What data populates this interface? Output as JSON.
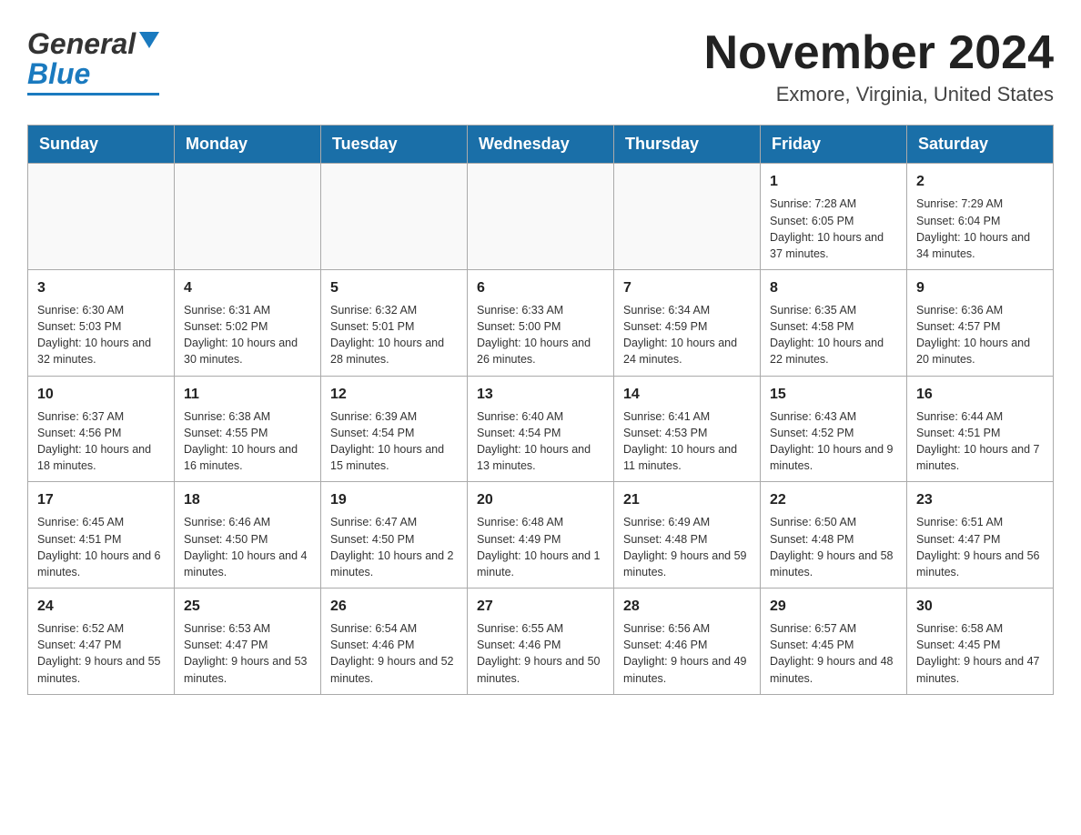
{
  "header": {
    "logo_general": "General",
    "logo_blue": "Blue",
    "title": "November 2024",
    "subtitle": "Exmore, Virginia, United States"
  },
  "calendar": {
    "days_of_week": [
      "Sunday",
      "Monday",
      "Tuesday",
      "Wednesday",
      "Thursday",
      "Friday",
      "Saturday"
    ],
    "weeks": [
      [
        {
          "day": "",
          "info": ""
        },
        {
          "day": "",
          "info": ""
        },
        {
          "day": "",
          "info": ""
        },
        {
          "day": "",
          "info": ""
        },
        {
          "day": "",
          "info": ""
        },
        {
          "day": "1",
          "info": "Sunrise: 7:28 AM\nSunset: 6:05 PM\nDaylight: 10 hours and 37 minutes."
        },
        {
          "day": "2",
          "info": "Sunrise: 7:29 AM\nSunset: 6:04 PM\nDaylight: 10 hours and 34 minutes."
        }
      ],
      [
        {
          "day": "3",
          "info": "Sunrise: 6:30 AM\nSunset: 5:03 PM\nDaylight: 10 hours and 32 minutes."
        },
        {
          "day": "4",
          "info": "Sunrise: 6:31 AM\nSunset: 5:02 PM\nDaylight: 10 hours and 30 minutes."
        },
        {
          "day": "5",
          "info": "Sunrise: 6:32 AM\nSunset: 5:01 PM\nDaylight: 10 hours and 28 minutes."
        },
        {
          "day": "6",
          "info": "Sunrise: 6:33 AM\nSunset: 5:00 PM\nDaylight: 10 hours and 26 minutes."
        },
        {
          "day": "7",
          "info": "Sunrise: 6:34 AM\nSunset: 4:59 PM\nDaylight: 10 hours and 24 minutes."
        },
        {
          "day": "8",
          "info": "Sunrise: 6:35 AM\nSunset: 4:58 PM\nDaylight: 10 hours and 22 minutes."
        },
        {
          "day": "9",
          "info": "Sunrise: 6:36 AM\nSunset: 4:57 PM\nDaylight: 10 hours and 20 minutes."
        }
      ],
      [
        {
          "day": "10",
          "info": "Sunrise: 6:37 AM\nSunset: 4:56 PM\nDaylight: 10 hours and 18 minutes."
        },
        {
          "day": "11",
          "info": "Sunrise: 6:38 AM\nSunset: 4:55 PM\nDaylight: 10 hours and 16 minutes."
        },
        {
          "day": "12",
          "info": "Sunrise: 6:39 AM\nSunset: 4:54 PM\nDaylight: 10 hours and 15 minutes."
        },
        {
          "day": "13",
          "info": "Sunrise: 6:40 AM\nSunset: 4:54 PM\nDaylight: 10 hours and 13 minutes."
        },
        {
          "day": "14",
          "info": "Sunrise: 6:41 AM\nSunset: 4:53 PM\nDaylight: 10 hours and 11 minutes."
        },
        {
          "day": "15",
          "info": "Sunrise: 6:43 AM\nSunset: 4:52 PM\nDaylight: 10 hours and 9 minutes."
        },
        {
          "day": "16",
          "info": "Sunrise: 6:44 AM\nSunset: 4:51 PM\nDaylight: 10 hours and 7 minutes."
        }
      ],
      [
        {
          "day": "17",
          "info": "Sunrise: 6:45 AM\nSunset: 4:51 PM\nDaylight: 10 hours and 6 minutes."
        },
        {
          "day": "18",
          "info": "Sunrise: 6:46 AM\nSunset: 4:50 PM\nDaylight: 10 hours and 4 minutes."
        },
        {
          "day": "19",
          "info": "Sunrise: 6:47 AM\nSunset: 4:50 PM\nDaylight: 10 hours and 2 minutes."
        },
        {
          "day": "20",
          "info": "Sunrise: 6:48 AM\nSunset: 4:49 PM\nDaylight: 10 hours and 1 minute."
        },
        {
          "day": "21",
          "info": "Sunrise: 6:49 AM\nSunset: 4:48 PM\nDaylight: 9 hours and 59 minutes."
        },
        {
          "day": "22",
          "info": "Sunrise: 6:50 AM\nSunset: 4:48 PM\nDaylight: 9 hours and 58 minutes."
        },
        {
          "day": "23",
          "info": "Sunrise: 6:51 AM\nSunset: 4:47 PM\nDaylight: 9 hours and 56 minutes."
        }
      ],
      [
        {
          "day": "24",
          "info": "Sunrise: 6:52 AM\nSunset: 4:47 PM\nDaylight: 9 hours and 55 minutes."
        },
        {
          "day": "25",
          "info": "Sunrise: 6:53 AM\nSunset: 4:47 PM\nDaylight: 9 hours and 53 minutes."
        },
        {
          "day": "26",
          "info": "Sunrise: 6:54 AM\nSunset: 4:46 PM\nDaylight: 9 hours and 52 minutes."
        },
        {
          "day": "27",
          "info": "Sunrise: 6:55 AM\nSunset: 4:46 PM\nDaylight: 9 hours and 50 minutes."
        },
        {
          "day": "28",
          "info": "Sunrise: 6:56 AM\nSunset: 4:46 PM\nDaylight: 9 hours and 49 minutes."
        },
        {
          "day": "29",
          "info": "Sunrise: 6:57 AM\nSunset: 4:45 PM\nDaylight: 9 hours and 48 minutes."
        },
        {
          "day": "30",
          "info": "Sunrise: 6:58 AM\nSunset: 4:45 PM\nDaylight: 9 hours and 47 minutes."
        }
      ]
    ]
  }
}
